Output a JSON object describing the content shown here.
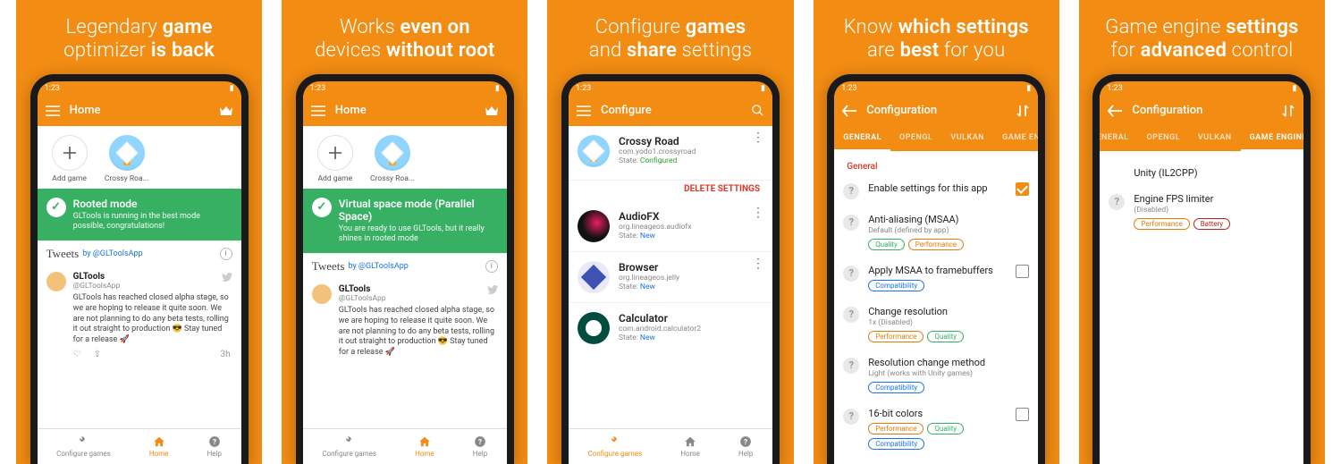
{
  "status_time": "1:23",
  "slides": [
    {
      "tagline_light_1": "Legendary ",
      "tagline_bold_1": "game",
      "tagline_light_2": "optimizer ",
      "tagline_bold_2": "is back"
    },
    {
      "tagline_light_1": "Works ",
      "tagline_bold_1": "even on",
      "tagline_light_2": "devices ",
      "tagline_bold_2": "without root"
    },
    {
      "tagline_light_1": "Configure ",
      "tagline_bold_1": "games",
      "tagline_light_2": "and ",
      "tagline_bold_2": "share",
      "tagline_light_3": " settings"
    },
    {
      "tagline_light_1": "Know ",
      "tagline_bold_1": "which settings",
      "tagline_light_2": "are ",
      "tagline_bold_2": "best",
      "tagline_light_3": " for you"
    },
    {
      "tagline_light_1": "Game engine ",
      "tagline_bold_1": "settings",
      "tagline_light_2": "for ",
      "tagline_bold_2": "advanced",
      "tagline_light_3": " control"
    }
  ],
  "home": {
    "title": "Home",
    "add_game": "Add game",
    "crossy": "Crossy Roa...",
    "tweets_label": "Tweets",
    "tweets_by": "by @GLToolsApp",
    "tweet_name": "GLTools",
    "tweet_handle": "@GLToolsApp",
    "tweet_body": "GLTools has reached closed alpha stage, so we are hoping to release it quite soon. We are not planning to do any beta tests, rolling it out straight to production 😎 Stay tuned for a release 🚀",
    "tweet_time": "3h",
    "nav": {
      "configure": "Configure games",
      "home": "Home",
      "help": "Help"
    }
  },
  "banner1": {
    "title": "Rooted mode",
    "sub": "GLTools is running in the best mode possible, congratulations!"
  },
  "banner2": {
    "title": "Virtual space mode (Parallel Space)",
    "sub": "You are ready to use GLTools, but it really shines in rooted mode"
  },
  "configure": {
    "title": "Configure",
    "delete": "DELETE SETTINGS",
    "state_label": "State: ",
    "apps": [
      {
        "name": "Crossy Road",
        "pkg": "com.yodo1.crossyroad",
        "state": "Configured",
        "stateClass": "val"
      },
      {
        "name": "AudioFX",
        "pkg": "org.lineageos.audiofx",
        "state": "New",
        "stateClass": "valb"
      },
      {
        "name": "Browser",
        "pkg": "org.lineageos.jelly",
        "state": "New",
        "stateClass": "valb"
      },
      {
        "name": "Calculator",
        "pkg": "com.android.calculator2",
        "state": "New",
        "stateClass": "valb"
      }
    ]
  },
  "config": {
    "title": "Configuration",
    "tabs": [
      "GENERAL",
      "OPENGL",
      "VULKAN",
      "GAME ENG"
    ],
    "tabs5": [
      "ENERAL",
      "OPENGL",
      "VULKAN",
      "GAME ENGINE"
    ],
    "section": "General",
    "rows": {
      "enable": "Enable settings for this app",
      "msaa": "Anti-aliasing (MSAA)",
      "msaa_sub": "Default (defined by app)",
      "msaa_fb": "Apply MSAA to framebuffers",
      "res": "Change resolution",
      "res_sub": "1x (Disabled)",
      "res_m": "Resolution change method",
      "res_m_sub": "Light (works with Unity games)",
      "bits": "16-bit colors"
    },
    "engine": {
      "unity": "Unity (IL2CPP)",
      "fps": "Engine FPS limiter",
      "fps_sub": "(Disabled)"
    },
    "pills": {
      "quality": "Quality",
      "perf": "Performance",
      "compat": "Compatibility",
      "batt": "Battery"
    }
  }
}
